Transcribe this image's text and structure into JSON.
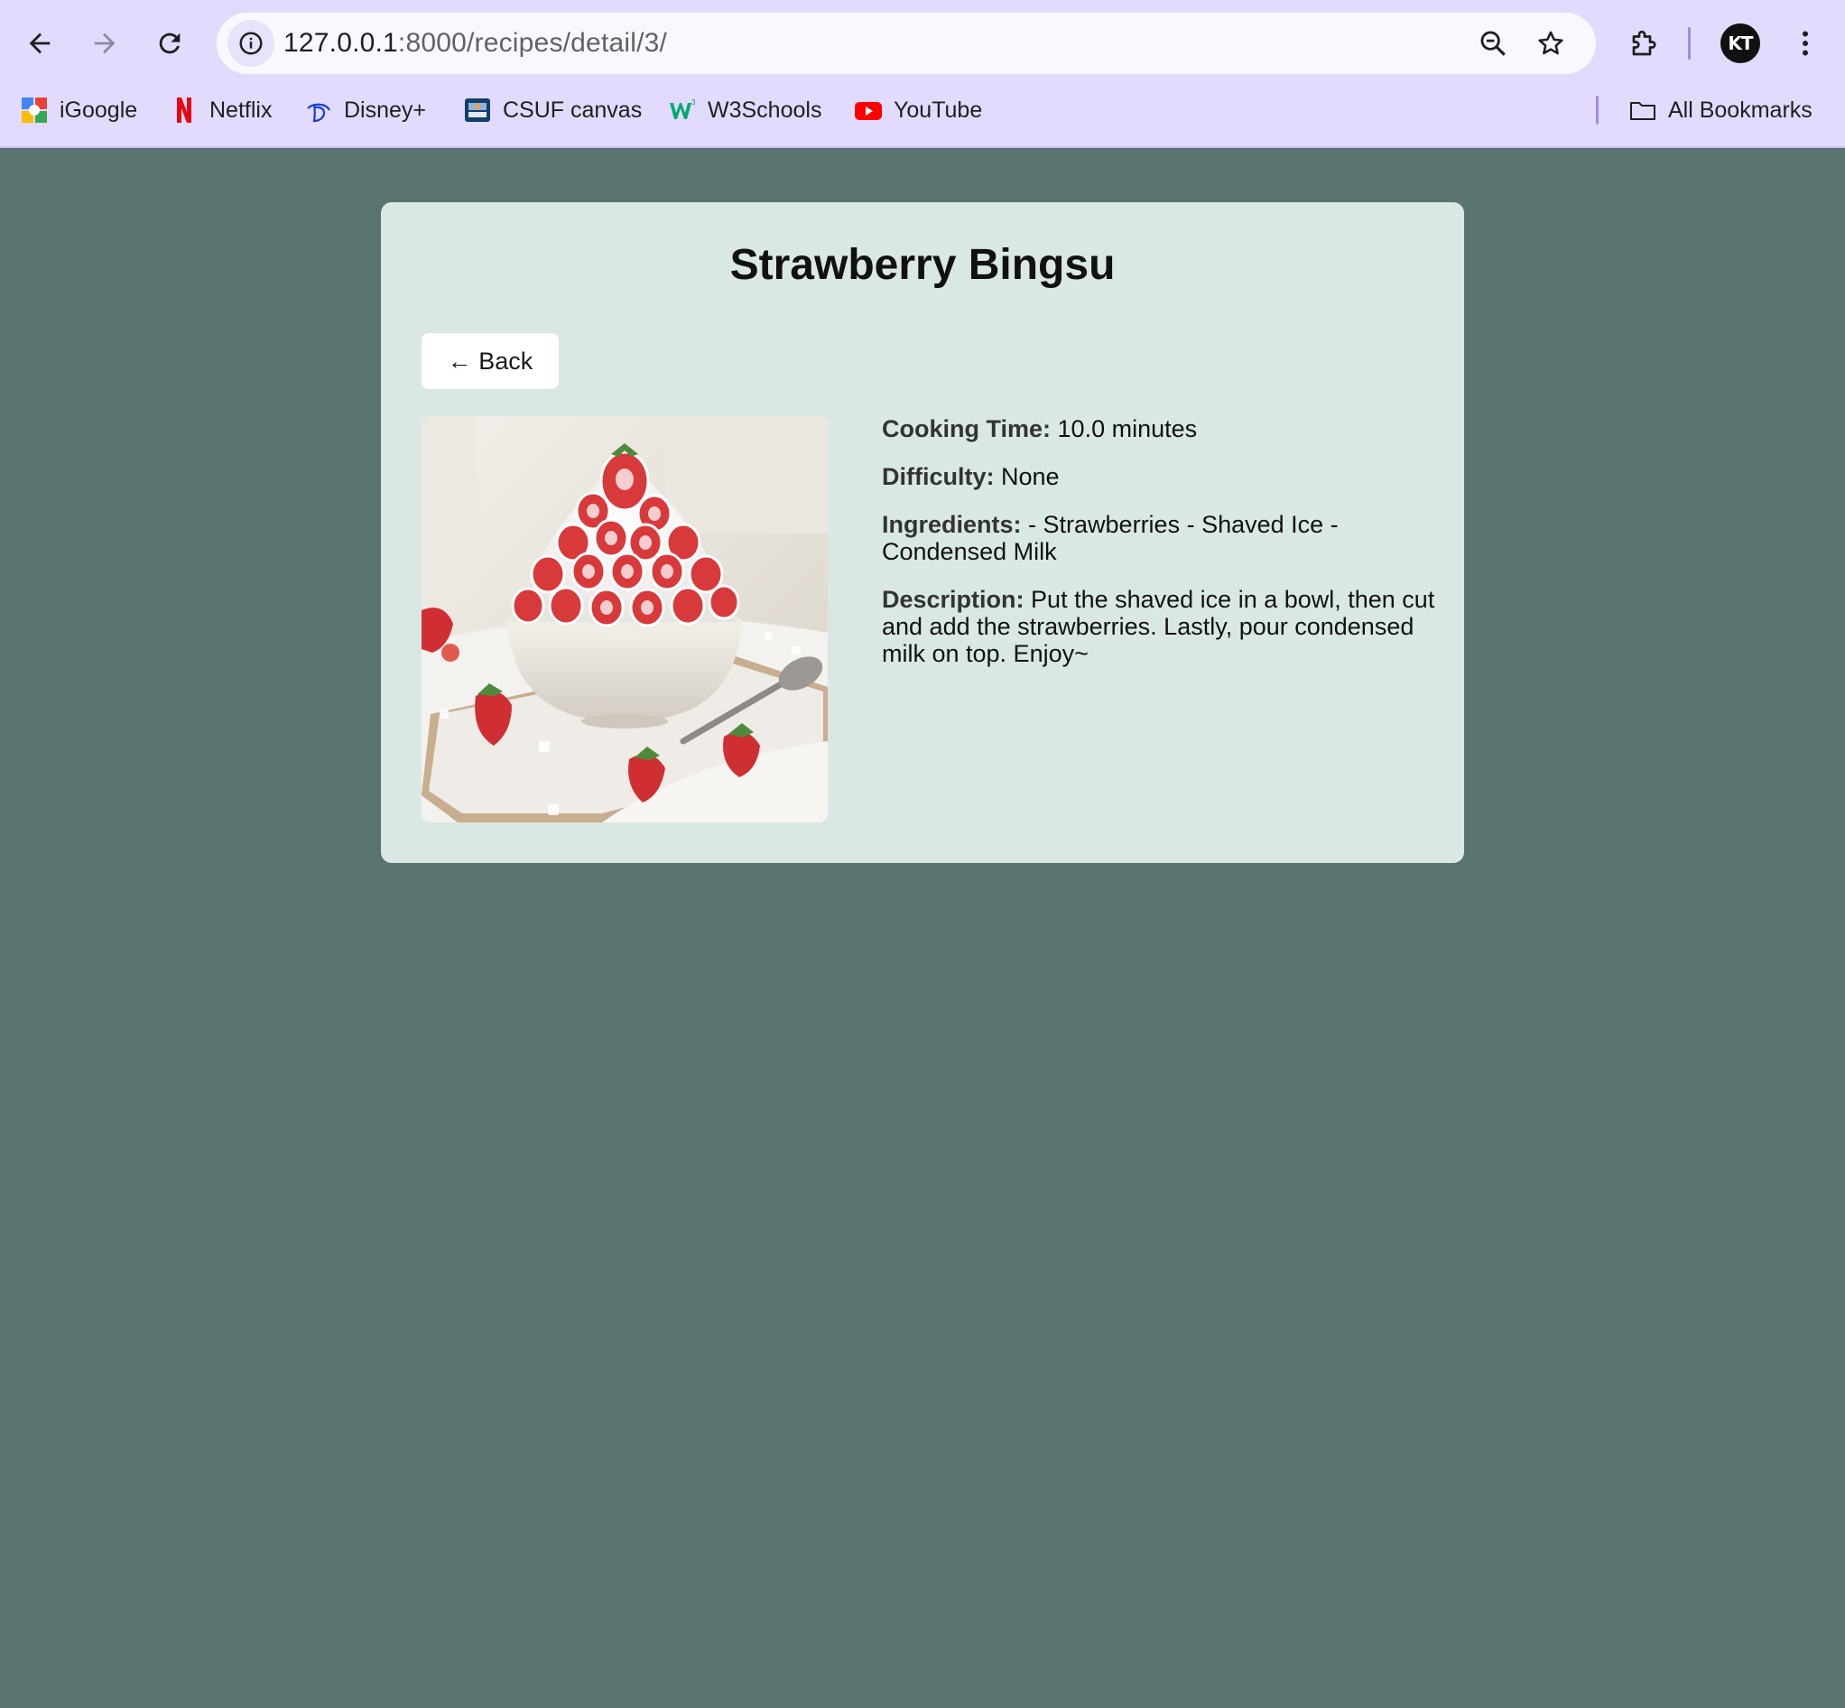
{
  "browser": {
    "url_host": "127.0.0.1",
    "url_path": ":8000/recipes/detail/3/",
    "avatar_initials": "KT",
    "bookmarks": [
      {
        "label": "iGoogle",
        "icon": "igoogle-icon"
      },
      {
        "label": "Netflix",
        "icon": "netflix-icon"
      },
      {
        "label": "Disney+",
        "icon": "disney-icon"
      },
      {
        "label": "CSUF canvas",
        "icon": "csuf-icon"
      },
      {
        "label": "W3Schools",
        "icon": "w3schools-icon"
      },
      {
        "label": "YouTube",
        "icon": "youtube-icon"
      }
    ],
    "all_bookmarks_label": "All Bookmarks"
  },
  "recipe": {
    "title": "Strawberry Bingsu",
    "back_label": "← Back",
    "cooking_time_label": "Cooking Time:",
    "cooking_time_value": "10.0 minutes",
    "difficulty_label": "Difficulty:",
    "difficulty_value": "None",
    "ingredients_label": "Ingredients:",
    "ingredients_value": "- Strawberries - Shaved Ice - Condensed Milk",
    "description_label": "Description:",
    "description_value": "Put the shaved ice in a bowl, then cut and add the strawberries. Lastly, pour condensed milk on top. Enjoy~"
  },
  "colors": {
    "page_background": "#587370",
    "card_background": "#d9e8e3",
    "chrome_background": "#e2dbfd"
  }
}
